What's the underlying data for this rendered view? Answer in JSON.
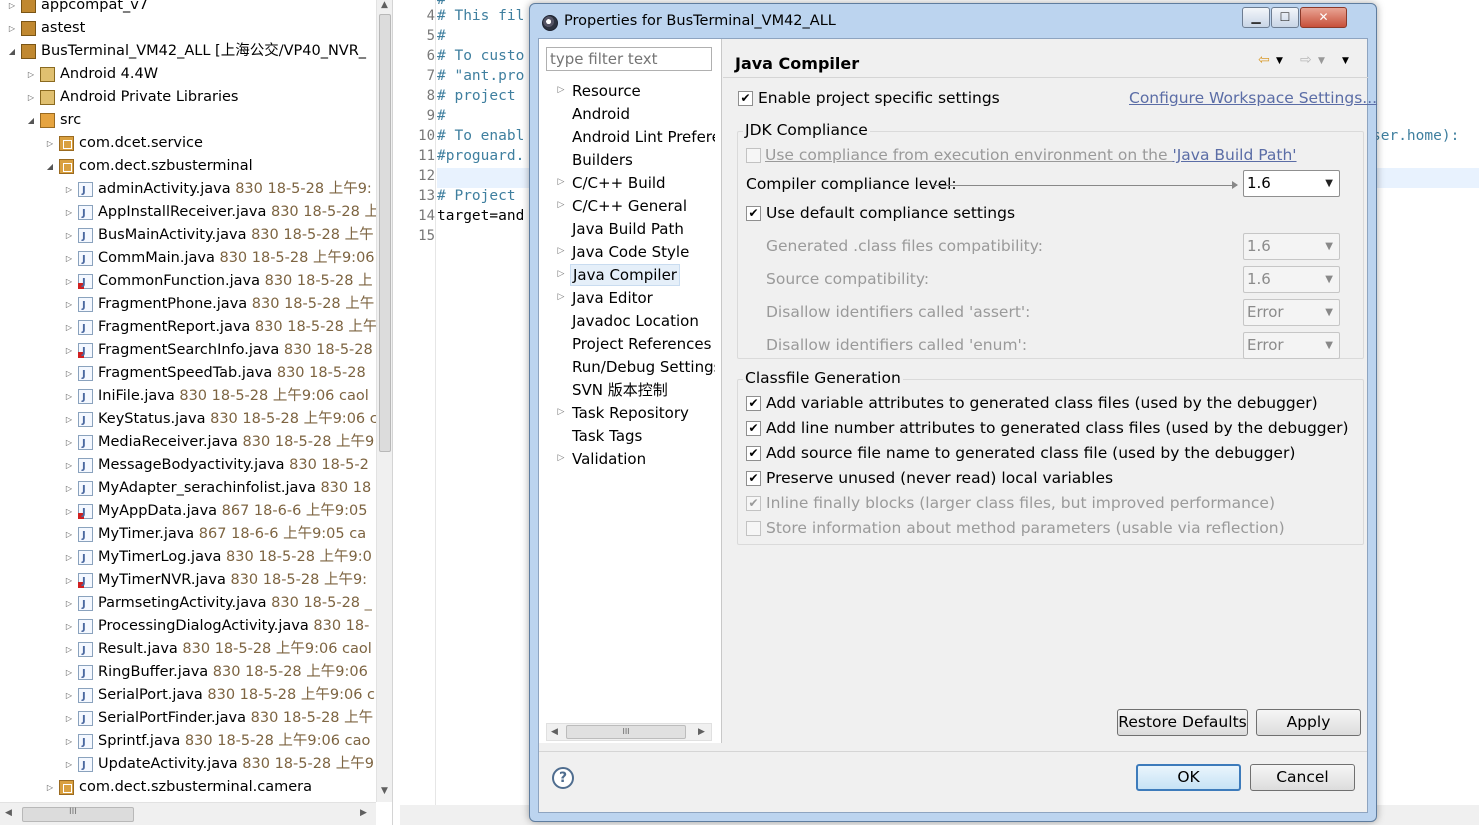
{
  "explorer": {
    "rows": [
      {
        "indent": 0,
        "twisty": "▷",
        "icon": "proj",
        "name": "appcompat_v7",
        "meta": ""
      },
      {
        "indent": 0,
        "twisty": "▷",
        "icon": "proj",
        "name": "astest",
        "meta": ""
      },
      {
        "indent": 0,
        "twisty": "◢",
        "icon": "proj",
        "name": "BusTerminal_VM42_ALL [上海公交/VP40_NVR_",
        "meta": ""
      },
      {
        "indent": 1,
        "twisty": "▷",
        "icon": "lib",
        "name": "Android 4.4W",
        "meta": ""
      },
      {
        "indent": 1,
        "twisty": "▷",
        "icon": "lib",
        "name": "Android Private Libraries",
        "meta": ""
      },
      {
        "indent": 1,
        "twisty": "◢",
        "icon": "src",
        "name": "src",
        "meta": ""
      },
      {
        "indent": 2,
        "twisty": "▷",
        "icon": "pkg",
        "name": "com.dcet.service",
        "meta": ""
      },
      {
        "indent": 2,
        "twisty": "◢",
        "icon": "pkg",
        "name": "com.dect.szbusterminal",
        "meta": ""
      },
      {
        "indent": 3,
        "twisty": "▷",
        "icon": "java",
        "name": "adminActivity.java",
        "meta": " 830  18-5-28 上午9:"
      },
      {
        "indent": 3,
        "twisty": "▷",
        "icon": "java",
        "name": "AppInstallReceiver.java",
        "meta": " 830  18-5-28 上"
      },
      {
        "indent": 3,
        "twisty": "▷",
        "icon": "java",
        "name": "BusMainActivity.java",
        "meta": " 830  18-5-28 上午"
      },
      {
        "indent": 3,
        "twisty": "▷",
        "icon": "java",
        "name": "CommMain.java",
        "meta": " 830  18-5-28 上午9:06"
      },
      {
        "indent": 3,
        "twisty": "▷",
        "icon": "java-err",
        "name": "CommonFunction.java",
        "meta": " 830  18-5-28 上"
      },
      {
        "indent": 3,
        "twisty": "▷",
        "icon": "java",
        "name": "FragmentPhone.java",
        "meta": " 830  18-5-28 上午"
      },
      {
        "indent": 3,
        "twisty": "▷",
        "icon": "java",
        "name": "FragmentReport.java",
        "meta": " 830  18-5-28 上午"
      },
      {
        "indent": 3,
        "twisty": "▷",
        "icon": "java-err",
        "name": "FragmentSearchInfo.java",
        "meta": " 830  18-5-28"
      },
      {
        "indent": 3,
        "twisty": "▷",
        "icon": "java",
        "name": "FragmentSpeedTab.java",
        "meta": " 830  18-5-28"
      },
      {
        "indent": 3,
        "twisty": "▷",
        "icon": "java",
        "name": "IniFile.java",
        "meta": " 830  18-5-28 上午9:06  caol"
      },
      {
        "indent": 3,
        "twisty": "▷",
        "icon": "java",
        "name": "KeyStatus.java",
        "meta": " 830  18-5-28 上午9:06  c"
      },
      {
        "indent": 3,
        "twisty": "▷",
        "icon": "java",
        "name": "MediaReceiver.java",
        "meta": " 830  18-5-28 上午9"
      },
      {
        "indent": 3,
        "twisty": "▷",
        "icon": "java",
        "name": "MessageBodyactivity.java",
        "meta": " 830  18-5-2"
      },
      {
        "indent": 3,
        "twisty": "▷",
        "icon": "java",
        "name": "MyAdapter_serachinfolist.java",
        "meta": " 830  18"
      },
      {
        "indent": 3,
        "twisty": "▷",
        "icon": "java-err",
        "name": "MyAppData.java",
        "meta": " 867  18-6-6 上午9:05"
      },
      {
        "indent": 3,
        "twisty": "▷",
        "icon": "java",
        "name": "MyTimer.java",
        "meta": " 867  18-6-6 上午9:05  ca"
      },
      {
        "indent": 3,
        "twisty": "▷",
        "icon": "java",
        "name": "MyTimerLog.java",
        "meta": " 830  18-5-28 上午9:0"
      },
      {
        "indent": 3,
        "twisty": "▷",
        "icon": "java-err",
        "name": "MyTimerNVR.java",
        "meta": " 830  18-5-28 上午9:"
      },
      {
        "indent": 3,
        "twisty": "▷",
        "icon": "java",
        "name": "ParmsetingActivity.java",
        "meta": " 830  18-5-28 _"
      },
      {
        "indent": 3,
        "twisty": "▷",
        "icon": "java",
        "name": "ProcessingDialogActivity.java",
        "meta": " 830  18-"
      },
      {
        "indent": 3,
        "twisty": "▷",
        "icon": "java",
        "name": "Result.java",
        "meta": " 830  18-5-28 上午9:06  caol"
      },
      {
        "indent": 3,
        "twisty": "▷",
        "icon": "java",
        "name": "RingBuffer.java",
        "meta": " 830  18-5-28 上午9:06"
      },
      {
        "indent": 3,
        "twisty": "▷",
        "icon": "java",
        "name": "SerialPort.java",
        "meta": " 830  18-5-28 上午9:06  c"
      },
      {
        "indent": 3,
        "twisty": "▷",
        "icon": "java",
        "name": "SerialPortFinder.java",
        "meta": " 830  18-5-28 上午"
      },
      {
        "indent": 3,
        "twisty": "▷",
        "icon": "java",
        "name": "Sprintf.java",
        "meta": " 830  18-5-28 上午9:06  cao"
      },
      {
        "indent": 3,
        "twisty": "▷",
        "icon": "java",
        "name": "UpdateActivity.java",
        "meta": " 830  18-5-28 上午9"
      },
      {
        "indent": 2,
        "twisty": "▷",
        "icon": "pkg",
        "name": "com.dect.szbusterminal.camera",
        "meta": ""
      }
    ],
    "hscroll_grip": "III"
  },
  "editor": {
    "lines": [
      {
        "n": "4",
        "text": "# This fil",
        "kind": "cmt"
      },
      {
        "n": "5",
        "text": "#",
        "kind": "cmt"
      },
      {
        "n": "6",
        "text": "# To custo",
        "kind": "cmt"
      },
      {
        "n": "7",
        "text": "# \"ant.pro",
        "kind": "cmt"
      },
      {
        "n": "8",
        "text": "# project",
        "kind": "cmt"
      },
      {
        "n": "9",
        "text": "#",
        "kind": "cmt"
      },
      {
        "n": "10",
        "text": "# To enabl",
        "kind": "cmt"
      },
      {
        "n": "11",
        "text": "#proguard.",
        "kind": "cmt"
      },
      {
        "n": "12",
        "text": "",
        "kind": "plain"
      },
      {
        "n": "13",
        "text": "# Project",
        "kind": "cmt"
      },
      {
        "n": "14",
        "text": "target=and",
        "kind": "plain"
      },
      {
        "n": "15",
        "text": "",
        "kind": "plain"
      }
    ],
    "right_snippet": "ser.home):",
    "top_fragment": "#"
  },
  "dialog": {
    "title": "Properties for BusTerminal_VM42_ALL",
    "window_buttons": {
      "minimize": "▁",
      "maximize": "☐",
      "close": "✕"
    },
    "filter_placeholder": "type filter text",
    "nav": [
      {
        "label": "Resource",
        "twisty": "▷"
      },
      {
        "label": "Android",
        "twisty": ""
      },
      {
        "label": "Android Lint Preferences",
        "twisty": ""
      },
      {
        "label": "Builders",
        "twisty": ""
      },
      {
        "label": "C/C++ Build",
        "twisty": "▷"
      },
      {
        "label": "C/C++ General",
        "twisty": "▷"
      },
      {
        "label": "Java Build Path",
        "twisty": ""
      },
      {
        "label": "Java Code Style",
        "twisty": "▷"
      },
      {
        "label": "Java Compiler",
        "twisty": "▷",
        "selected": true
      },
      {
        "label": "Java Editor",
        "twisty": "▷"
      },
      {
        "label": "Javadoc Location",
        "twisty": ""
      },
      {
        "label": "Project References",
        "twisty": ""
      },
      {
        "label": "Run/Debug Settings",
        "twisty": ""
      },
      {
        "label": "SVN 版本控制",
        "twisty": ""
      },
      {
        "label": "Task Repository",
        "twisty": "▷"
      },
      {
        "label": "Task Tags",
        "twisty": ""
      },
      {
        "label": "Validation",
        "twisty": "▷"
      }
    ],
    "nav_hscroll_grip": "III",
    "page": {
      "title": "Java Compiler",
      "enable_project_specific": {
        "label": "Enable project specific settings",
        "checked": true
      },
      "configure_link": "Configure Workspace Settings...",
      "jdk_group": {
        "title": "JDK Compliance",
        "use_compliance_env": {
          "label_prefix": "Use compliance from execution environment on the ",
          "link": "'Java Build Path'",
          "checked": false,
          "enabled": false
        },
        "compliance_level_label": "Compiler compliance level:",
        "compliance_level_value": "1.6",
        "use_default": {
          "label": "Use default compliance settings",
          "checked": true
        },
        "rows": [
          {
            "label": "Generated .class files compatibility:",
            "value": "1.6"
          },
          {
            "label": "Source compatibility:",
            "value": "1.6"
          },
          {
            "label": "Disallow identifiers called 'assert':",
            "value": "Error"
          },
          {
            "label": "Disallow identifiers called 'enum':",
            "value": "Error"
          }
        ]
      },
      "classfile_group": {
        "title": "Classfile Generation",
        "options": [
          {
            "label": "Add variable attributes to generated class files (used by the debugger)",
            "checked": true,
            "enabled": true
          },
          {
            "label": "Add line number attributes to generated class files (used by the debugger)",
            "checked": true,
            "enabled": true
          },
          {
            "label": "Add source file name to generated class file (used by the debugger)",
            "checked": true,
            "enabled": true
          },
          {
            "label": "Preserve unused (never read) local variables",
            "checked": true,
            "enabled": true
          },
          {
            "label": "Inline finally blocks (larger class files, but improved performance)",
            "checked": true,
            "enabled": false
          },
          {
            "label": "Store information about method parameters (usable via reflection)",
            "checked": false,
            "enabled": false
          }
        ]
      },
      "restore_defaults": "Restore Defaults",
      "apply": "Apply"
    },
    "ok": "OK",
    "cancel": "Cancel",
    "help": "?"
  },
  "colors": {
    "selection": "#e5eff9",
    "link": "#5b6da6",
    "comment": "#3f7f9f",
    "meta": "#7d6441"
  }
}
